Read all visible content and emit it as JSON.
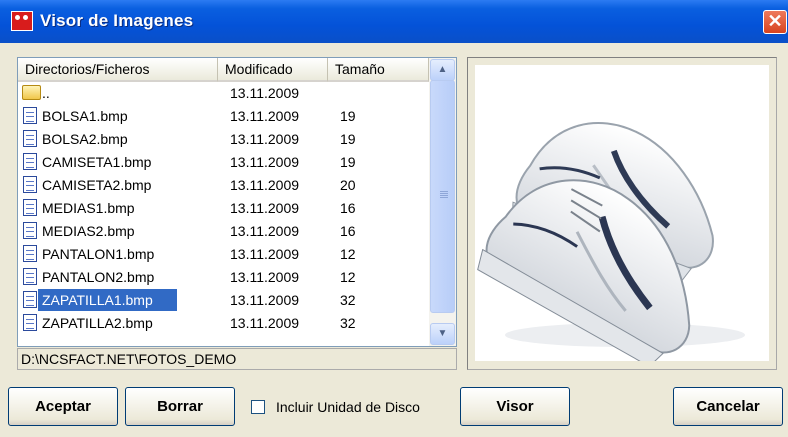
{
  "window": {
    "title": "Visor de Imagenes",
    "close_glyph": "✕"
  },
  "file_list": {
    "columns": [
      "Directorios/Ficheros",
      "Modificado",
      "Tamaño"
    ],
    "rows": [
      {
        "name": "..",
        "modified": "13.11.2009",
        "size": "",
        "icon": "folder-icon",
        "selected": false
      },
      {
        "name": "BOLSA1.bmp",
        "modified": "13.11.2009",
        "size": "19",
        "icon": "file-icon",
        "selected": false
      },
      {
        "name": "BOLSA2.bmp",
        "modified": "13.11.2009",
        "size": "19",
        "icon": "file-icon",
        "selected": false
      },
      {
        "name": "CAMISETA1.bmp",
        "modified": "13.11.2009",
        "size": "19",
        "icon": "file-icon",
        "selected": false
      },
      {
        "name": "CAMISETA2.bmp",
        "modified": "13.11.2009",
        "size": "20",
        "icon": "file-icon",
        "selected": false
      },
      {
        "name": "MEDIAS1.bmp",
        "modified": "13.11.2009",
        "size": "16",
        "icon": "file-icon",
        "selected": false
      },
      {
        "name": "MEDIAS2.bmp",
        "modified": "13.11.2009",
        "size": "16",
        "icon": "file-icon",
        "selected": false
      },
      {
        "name": "PANTALON1.bmp",
        "modified": "13.11.2009",
        "size": "12",
        "icon": "file-icon",
        "selected": false
      },
      {
        "name": "PANTALON2.bmp",
        "modified": "13.11.2009",
        "size": "12",
        "icon": "file-icon",
        "selected": false
      },
      {
        "name": "ZAPATILLA1.bmp",
        "modified": "13.11.2009",
        "size": "32",
        "icon": "file-icon",
        "selected": true
      },
      {
        "name": "ZAPATILLA2.bmp",
        "modified": "13.11.2009",
        "size": "32",
        "icon": "file-icon",
        "selected": false
      }
    ],
    "scroll_up_glyph": "▲",
    "scroll_down_glyph": "▼"
  },
  "path": "D:\\NCSFACT.NET\\FOTOS_DEMO",
  "preview": {
    "image": "sneakers-image"
  },
  "buttons": {
    "accept": "Aceptar",
    "delete": "Borrar",
    "viewer": "Visor",
    "cancel": "Cancelar"
  },
  "include_drive": {
    "label": "Incluir Unidad de Disco",
    "checked": false
  },
  "colors": {
    "titlebar": "#0452d8",
    "selection": "#316ac5",
    "dialog_bg": "#ece9d8"
  }
}
